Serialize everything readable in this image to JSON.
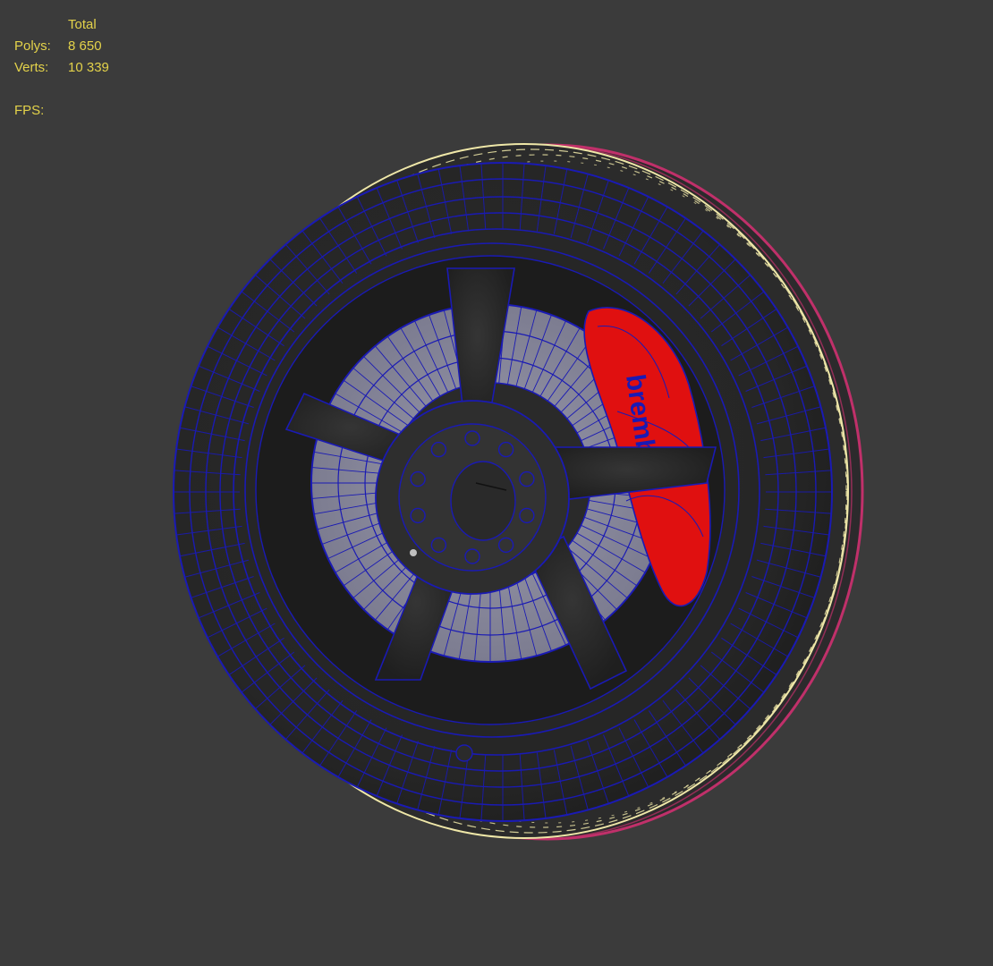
{
  "stats": {
    "header": "Total",
    "polys_label": "Polys:",
    "polys_value": "8 650",
    "verts_label": "Verts:",
    "verts_value": "10 339",
    "fps_label": "FPS:"
  },
  "model": {
    "caliper_text": "brembo"
  },
  "colors": {
    "background": "#3b3b3b",
    "stats_text": "#e3d24a",
    "wire_blue": "#1a1ab4",
    "tire_edge": "#efe7a8",
    "tire_rim": "#c0306a",
    "caliper_red": "#e01010",
    "disc_grey": "#8e8ea0"
  }
}
